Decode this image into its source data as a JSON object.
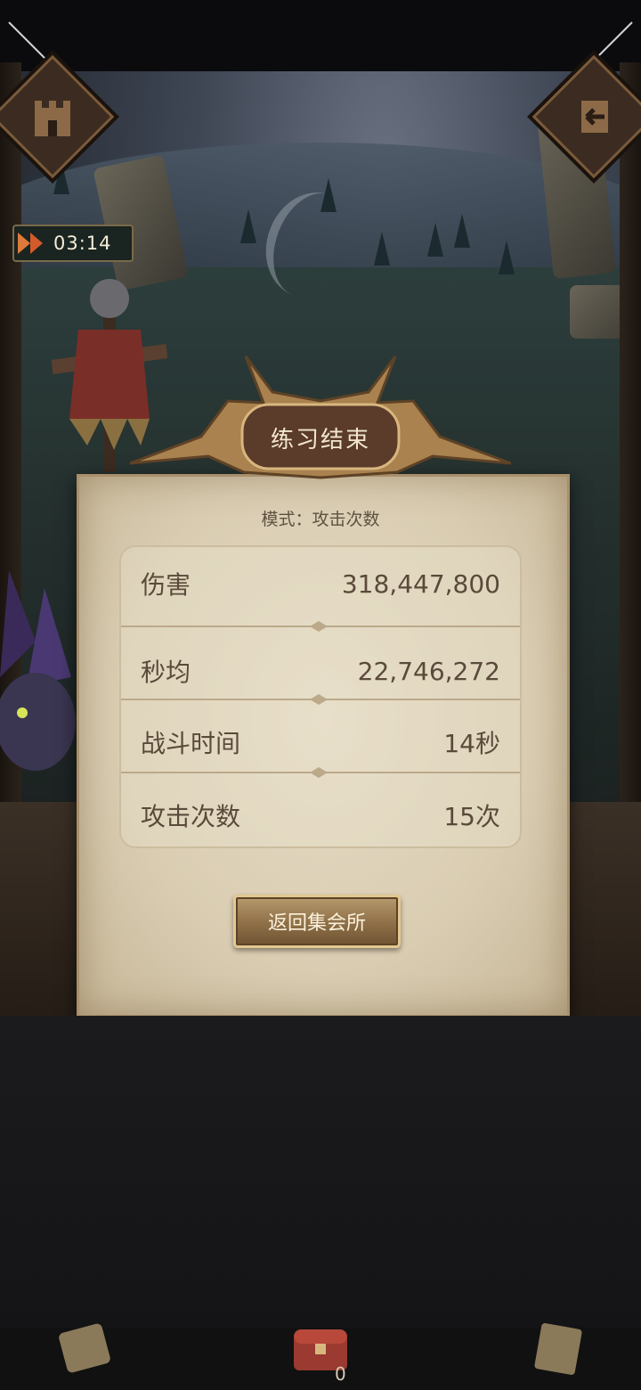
{
  "hud": {
    "timer": "03:14"
  },
  "dialog": {
    "title": "练习结束",
    "mode": "模式：攻击次数",
    "stats": [
      {
        "label": "伤害",
        "value": "318,447,800"
      },
      {
        "label": "秒均",
        "value": "22,746,272"
      },
      {
        "label": "战斗时间",
        "value": "14秒"
      },
      {
        "label": "攻击次数",
        "value": "15次"
      }
    ],
    "return_button": "返回集会所"
  },
  "bottom_bar": {
    "chest_count": "0"
  },
  "colors": {
    "parchment": "#d9ccb1",
    "text_brown": "#5a4a3a",
    "button_gold": "#8e6f47"
  }
}
